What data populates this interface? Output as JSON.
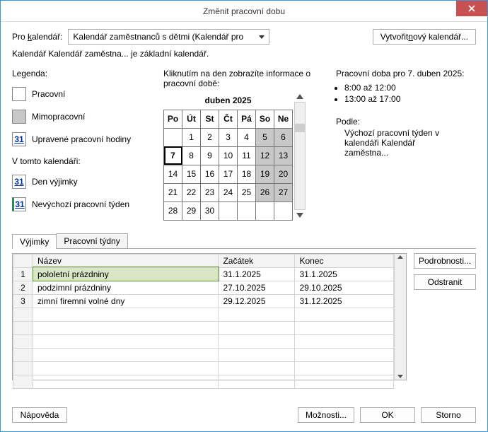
{
  "title": "Změnit pracovní dobu",
  "labels": {
    "for_calendar_pre": "Pro ",
    "for_calendar_u": "k",
    "for_calendar_post": "alendář:",
    "new_calendar_pre": "Vytvořit ",
    "new_calendar_u": "n",
    "new_calendar_post": "ový kalendář...",
    "base_note": "Kalendář Kalendář zaměstna... je základní kalendář.",
    "legend": "Legenda:",
    "l_work": "Pracovní",
    "l_nonwork": "Mimopracovní",
    "l_edited": "Upravené pracovní hodiny",
    "in_this_cal": "V tomto kalendáři:",
    "l_exception": "Den výjimky",
    "l_nondef": "Nevýchozí pracovní týden",
    "click_info": "Kliknutím na den zobrazíte informace o pracovní době:",
    "month_header": "duben 2025",
    "wh_header": "Pracovní doba pro 7. duben 2025:",
    "wh1": "8:00 až 12:00",
    "wh2": "13:00 až 17:00",
    "based_on": "Podle:",
    "based_detail1": "Výchozí pracovní týden v",
    "based_detail2": "kalendáři Kalendář",
    "based_detail3": "zaměstna...",
    "tab_exceptions": "Výjimky",
    "tab_weeks": "Pracovní týdny",
    "col_name": "Název",
    "col_start": "Začátek",
    "col_end": "Konec",
    "details_btn_pre": "Po",
    "details_btn_u": "d",
    "details_btn_post": "robnosti...",
    "remove_btn_pre": "O",
    "remove_btn_u": "d",
    "remove_btn_post": "stranit",
    "help_btn_pre": "Nápo",
    "help_btn_u": "v",
    "help_btn_post": "ěda",
    "options_btn_pre": "",
    "options_btn_u": "M",
    "options_btn_post": "ožnosti...",
    "ok": "OK",
    "cancel": "Storno",
    "swatch31": "31"
  },
  "combo_value": "Kalendář zaměstnanců s dětmi (Kalendář pro",
  "days": [
    "Po",
    "Út",
    "St",
    "Čt",
    "Pá",
    "So",
    "Ne"
  ],
  "calendar": [
    [
      "",
      "1",
      "2",
      "3",
      "4",
      "5",
      "6"
    ],
    [
      "7",
      "8",
      "9",
      "10",
      "11",
      "12",
      "13"
    ],
    [
      "14",
      "15",
      "16",
      "17",
      "18",
      "19",
      "20"
    ],
    [
      "21",
      "22",
      "23",
      "24",
      "25",
      "26",
      "27"
    ],
    [
      "28",
      "29",
      "30",
      "",
      "",
      "",
      ""
    ]
  ],
  "exceptions": [
    {
      "n": "1",
      "name": "pololetní prázdniny",
      "start": "31.1.2025",
      "end": "31.1.2025"
    },
    {
      "n": "2",
      "name": "podzimní prázdniny",
      "start": "27.10.2025",
      "end": "29.10.2025"
    },
    {
      "n": "3",
      "name": "zimní firemní volné dny",
      "start": "29.12.2025",
      "end": "31.12.2025"
    }
  ]
}
